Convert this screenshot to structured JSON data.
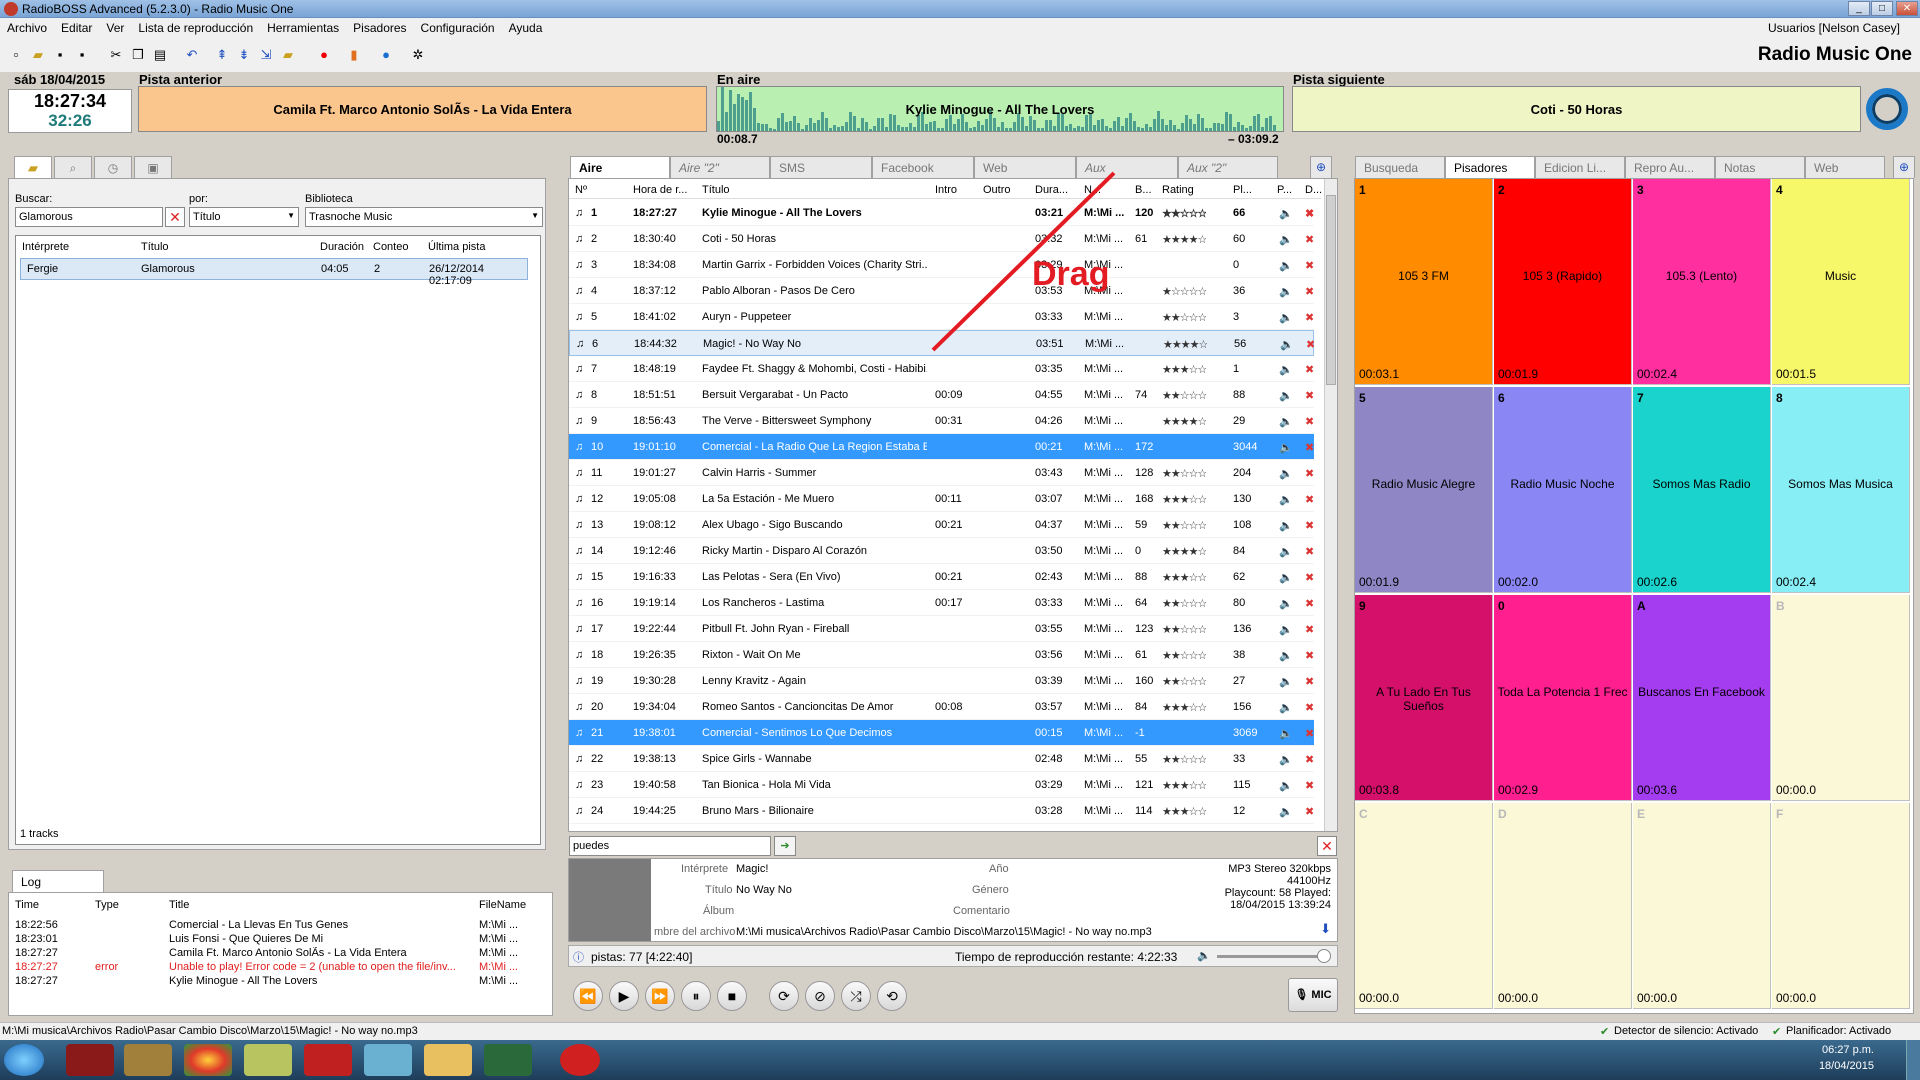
{
  "window": {
    "title": "RadioBOSS Advanced (5.2.3.0) - Radio Music One",
    "buttons": [
      "_",
      "□",
      "✕"
    ]
  },
  "menu": [
    "Archivo",
    "Editar",
    "Ver",
    "Lista de reproducción",
    "Herramientas",
    "Pisadores",
    "Configuración",
    "Ayuda"
  ],
  "user": "Usuarios [Nelson Casey]",
  "station": "Radio Music One",
  "clock": {
    "date": "sáb 18/04/2015",
    "time": "18:27:34",
    "remaining": "32:26"
  },
  "labels": {
    "prev": "Pista anterior",
    "cur": "En aire",
    "next": "Pista siguiente"
  },
  "tracks": {
    "prev": "Camila Ft. Marco Antonio SolÃs - La Vida Entera",
    "cur": "Kylie Minogue - All The Lovers",
    "next": "Coti - 50 Horas",
    "elapsed": "00:08.7",
    "left": "– 03:09.2"
  },
  "search": {
    "buscar_label": "Buscar:",
    "buscar_value": "Glamorous",
    "por_label": "por:",
    "por_value": "Título",
    "bib_label": "Biblioteca",
    "bib_value": "Trasnoche Music",
    "headers": [
      "Intérprete",
      "Título",
      "Duración",
      "Conteo",
      "Última pista"
    ],
    "rows": [
      [
        "Fergie",
        "Glamorous",
        "04:05",
        "2",
        "26/12/2014 02:17:09"
      ]
    ],
    "count": "1 tracks"
  },
  "center_tabs": [
    "Aire",
    "Aire \"2\"",
    "SMS",
    "Facebook",
    "Web",
    "Aux",
    "Aux \"2\""
  ],
  "pl_headers": [
    "Nº",
    "Hora de r...",
    "Título",
    "Intro",
    "Outro",
    "Dura...",
    "N...",
    "B...",
    "Rating",
    "Pl...",
    "P...",
    "D..."
  ],
  "playlist": [
    [
      "1",
      "18:27:27",
      "Kylie Minogue - All The Lovers",
      "",
      "",
      "03:21",
      "M:\\Mi ...",
      "120",
      "★★☆☆☆",
      "66"
    ],
    [
      "2",
      "18:30:40",
      "Coti - 50 Horas",
      "",
      "",
      "03:32",
      "M:\\Mi ...",
      "61",
      "★★★★☆",
      "60"
    ],
    [
      "3",
      "18:34:08",
      "Martin Garrix - Forbidden Voices (Charity Stri...",
      "",
      "",
      "03:29",
      "M:\\Mi ...",
      "",
      "",
      "0"
    ],
    [
      "4",
      "18:37:12",
      "Pablo Alboran - Pasos De Cero",
      "",
      "",
      "03:53",
      "M:\\Mi ...",
      "",
      "★☆☆☆☆",
      "36"
    ],
    [
      "5",
      "18:41:02",
      "Auryn - Puppeteer",
      "",
      "",
      "03:33",
      "M:\\Mi ...",
      "",
      "★★☆☆☆",
      "3"
    ],
    [
      "6",
      "18:44:32",
      "Magic! - No Way No",
      "",
      "",
      "03:51",
      "M:\\Mi ...",
      "",
      "★★★★☆",
      "56"
    ],
    [
      "7",
      "18:48:19",
      "Faydee Ft. Shaggy & Mohombi, Costi - Habibi...",
      "",
      "",
      "03:35",
      "M:\\Mi ...",
      "",
      "★★★☆☆",
      "1"
    ],
    [
      "8",
      "18:51:51",
      "Bersuit Vergarabat - Un Pacto",
      "00:09",
      "",
      "04:55",
      "M:\\Mi ...",
      "74",
      "★★☆☆☆",
      "88"
    ],
    [
      "9",
      "18:56:43",
      "The Verve - Bittersweet Symphony",
      "00:31",
      "",
      "04:26",
      "M:\\Mi ...",
      "",
      "★★★★☆",
      "29"
    ],
    [
      "10",
      "19:01:10",
      "Comercial - La Radio Que La Region Estaba E...",
      "",
      "",
      "00:21",
      "M:\\Mi ...",
      "172",
      "",
      "3044"
    ],
    [
      "11",
      "19:01:27",
      "Calvin Harris - Summer",
      "",
      "",
      "03:43",
      "M:\\Mi ...",
      "128",
      "★★☆☆☆",
      "204"
    ],
    [
      "12",
      "19:05:08",
      "La 5a Estación - Me Muero",
      "00:11",
      "",
      "03:07",
      "M:\\Mi ...",
      "168",
      "★★★☆☆",
      "130"
    ],
    [
      "13",
      "19:08:12",
      "Alex Ubago - Sigo Buscando",
      "00:21",
      "",
      "04:37",
      "M:\\Mi ...",
      "59",
      "★★☆☆☆",
      "108"
    ],
    [
      "14",
      "19:12:46",
      "Ricky Martin - Disparo Al Corazón",
      "",
      "",
      "03:50",
      "M:\\Mi ...",
      "0",
      "★★★★☆",
      "84"
    ],
    [
      "15",
      "19:16:33",
      "Las Pelotas - Sera (En Vivo)",
      "00:21",
      "",
      "02:43",
      "M:\\Mi ...",
      "88",
      "★★★☆☆",
      "62"
    ],
    [
      "16",
      "19:19:14",
      "Los Rancheros - Lastima",
      "00:17",
      "",
      "03:33",
      "M:\\Mi ...",
      "64",
      "★★☆☆☆",
      "80"
    ],
    [
      "17",
      "19:22:44",
      "Pitbull Ft. John Ryan - Fireball",
      "",
      "",
      "03:55",
      "M:\\Mi ...",
      "123",
      "★★☆☆☆",
      "136"
    ],
    [
      "18",
      "19:26:35",
      "Rixton - Wait On Me",
      "",
      "",
      "03:56",
      "M:\\Mi ...",
      "61",
      "★★☆☆☆",
      "38"
    ],
    [
      "19",
      "19:30:28",
      "Lenny Kravitz - Again",
      "",
      "",
      "03:39",
      "M:\\Mi ...",
      "160",
      "★★☆☆☆",
      "27"
    ],
    [
      "20",
      "19:34:04",
      "Romeo Santos - Cancioncitas De Amor",
      "00:08",
      "",
      "03:57",
      "M:\\Mi ...",
      "84",
      "★★★☆☆",
      "156"
    ],
    [
      "21",
      "19:38:01",
      "Comercial - Sentimos Lo Que Decimos",
      "",
      "",
      "00:15",
      "M:\\Mi ...",
      "-1",
      "",
      "3069"
    ],
    [
      "22",
      "19:38:13",
      "Spice Girls - Wannabe",
      "",
      "",
      "02:48",
      "M:\\Mi ...",
      "55",
      "★★☆☆☆",
      "33"
    ],
    [
      "23",
      "19:40:58",
      "Tan Bionica - Hola Mi Vida",
      "",
      "",
      "03:29",
      "M:\\Mi ...",
      "121",
      "★★★☆☆",
      "115"
    ],
    [
      "24",
      "19:44:25",
      "Bruno Mars - Bilionaire",
      "",
      "",
      "03:28",
      "M:\\Mi ...",
      "114",
      "★★★☆☆",
      "12"
    ]
  ],
  "drag_text": "Drag",
  "filter": {
    "value": "puedes"
  },
  "info": {
    "interp_l": "Intérprete",
    "interp": "Magic!",
    "title_l": "Título",
    "title": "No Way No",
    "album_l": "Álbum",
    "ano_l": "Año",
    "genero_l": "Género",
    "coment_l": "Comentario",
    "file_l": "mbre del archivo",
    "file": "M:\\Mi musica\\Archivos Radio\\Pasar Cambio Disco\\Marzo\\15\\Magic! - No way no.mp3",
    "fmt": "MP3 Stereo 320kbps",
    "rate": "44100Hz",
    "playcount": "Playcount: 58  Played:",
    "played": "18/04/2015 13:39:24"
  },
  "status_center": {
    "tracks": "pistas: 77 [4:22:40]",
    "remaining": "Tiempo de reproducción restante: 4:22:33"
  },
  "mic": "MIC",
  "right_tabs": [
    "Busqueda",
    "Pisadores",
    "Edicion Li...",
    "Repro Au...",
    "Notas",
    "Web"
  ],
  "pads": [
    {
      "k": "1",
      "l": "105 3 FM",
      "t": "00:03.1",
      "c": "#ff8c00"
    },
    {
      "k": "2",
      "l": "105 3 (Rapido)",
      "t": "00:01.9",
      "c": "#ff0000"
    },
    {
      "k": "3",
      "l": "105.3 (Lento)",
      "t": "00:02.4",
      "c": "#ff2fa0"
    },
    {
      "k": "4",
      "l": "Music",
      "t": "00:01.5",
      "c": "#f7f76a"
    },
    {
      "k": "5",
      "l": "Radio Music Alegre",
      "t": "00:01.9",
      "c": "#8f86c6"
    },
    {
      "k": "6",
      "l": "Radio Music Noche",
      "t": "00:02.0",
      "c": "#8a87f5"
    },
    {
      "k": "7",
      "l": "Somos Mas Radio",
      "t": "00:02.6",
      "c": "#19d3cc"
    },
    {
      "k": "8",
      "l": "Somos Mas Musica",
      "t": "00:02.4",
      "c": "#86eef4"
    },
    {
      "k": "9",
      "l": "A Tu Lado En Tus Sueños",
      "t": "00:03.8",
      "c": "#d4106b"
    },
    {
      "k": "0",
      "l": "Toda La Potencia 1 Frec",
      "t": "00:02.9",
      "c": "#ff1f8f"
    },
    {
      "k": "A",
      "l": "Buscanos En Facebook",
      "t": "00:03.6",
      "c": "#a43cf0"
    },
    {
      "k": "B",
      "l": "",
      "t": "00:00.0",
      "c": "#fbf8d8"
    },
    {
      "k": "C",
      "l": "",
      "t": "00:00.0",
      "c": "#fbf8d8"
    },
    {
      "k": "D",
      "l": "",
      "t": "00:00.0",
      "c": "#fbf8d8"
    },
    {
      "k": "E",
      "l": "",
      "t": "00:00.0",
      "c": "#fbf8d8"
    },
    {
      "k": "F",
      "l": "",
      "t": "00:00.0",
      "c": "#fbf8d8"
    }
  ],
  "log": {
    "tab": "Log",
    "headers": [
      "Time",
      "Type",
      "Title",
      "FileName"
    ],
    "rows": [
      [
        "18:22:56",
        "",
        "Comercial - La Llevas En Tus Genes",
        "M:\\Mi ..."
      ],
      [
        "18:23:01",
        "",
        "Luis Fonsi - Que Quieres De Mi",
        "M:\\Mi ..."
      ],
      [
        "18:27:27",
        "",
        "Camila Ft. Marco Antonio SolÃ­s - La Vida Entera",
        "M:\\Mi ..."
      ],
      [
        "18:27:27",
        "error",
        "Unable to play! Error code = 2 (unable to open the file/inv...",
        "M:\\Mi ..."
      ],
      [
        "18:27:27",
        "",
        "Kylie Minogue - All The Lovers",
        "M:\\Mi ..."
      ]
    ]
  },
  "statusbar": {
    "path": "M:\\Mi musica\\Archivos Radio\\Pasar Cambio Disco\\Marzo\\15\\Magic! - No way no.mp3",
    "silence": "Detector de silencio: Activado",
    "planner": "Planificador: Activado"
  },
  "taskbar": {
    "time": "06:27 p.m.",
    "date": "18/04/2015"
  }
}
